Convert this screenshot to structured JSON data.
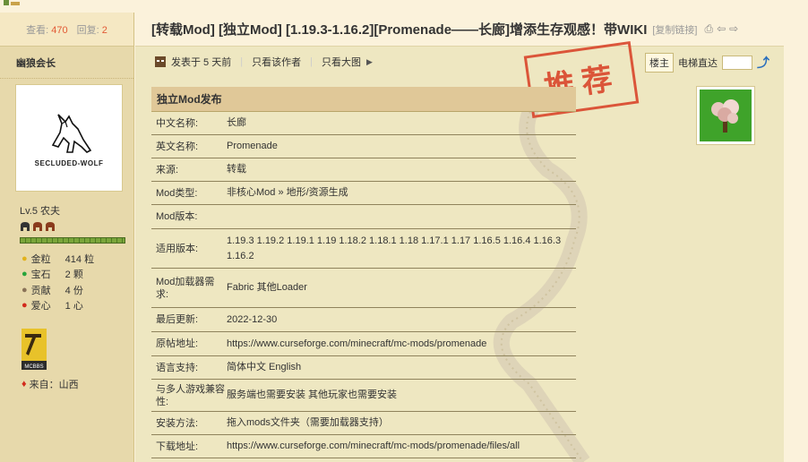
{
  "stats": {
    "views_label": "查看:",
    "views": "470",
    "replies_label": "回复:",
    "replies": "2"
  },
  "user": {
    "name": "幽狼会长",
    "avatar_text": "SECLUDED-WOLF",
    "level": "Lv.5 农夫",
    "gold_label": "金粒",
    "gold": "414 粒",
    "gem_label": "宝石",
    "gem": "2 颗",
    "contrib_label": "贡献",
    "contrib": "4 份",
    "love_label": "爱心",
    "love": "1 心",
    "from": "来自：山西"
  },
  "post": {
    "title": "[转载Mod] [独立Mod] [1.19.3-1.16.2][Promenade——长廊]增添生存观感！带WIKI",
    "copy_link": "[复制链接]",
    "posted": "发表于 5 天前",
    "author_only": "只看该作者",
    "big_images": "只看大图",
    "floor": "楼主",
    "jump_label": "电梯直达",
    "stamp": "推荐"
  },
  "info_table": {
    "header": "独立Mod发布",
    "rows": [
      {
        "k": "中文名称:",
        "v": "长廊"
      },
      {
        "k": "英文名称:",
        "v": "Promenade"
      },
      {
        "k": "来源:",
        "v": "转载"
      },
      {
        "k": "Mod类型:",
        "v": "非核心Mod » 地形/资源生成"
      },
      {
        "k": "Mod版本:",
        "v": ""
      },
      {
        "k": "适用版本:",
        "v": "1.19.3 1.19.2 1.19.1 1.19 1.18.2 1.18.1 1.18 1.17.1 1.17 1.16.5 1.16.4 1.16.3 1.16.2"
      },
      {
        "k": "Mod加载器需求:",
        "v": "Fabric 其他Loader"
      },
      {
        "k": "最后更新:",
        "v": "2022-12-30"
      },
      {
        "k": "原帖地址:",
        "v": "https://www.curseforge.com/minecraft/mc-mods/promenade"
      },
      {
        "k": "语言支持:",
        "v": "简体中文 English"
      },
      {
        "k": "与多人游戏兼容性:",
        "v": "服务端也需要安装 其他玩家也需要安装"
      },
      {
        "k": "安装方法:",
        "v": "拖入mods文件夹（需要加载器支持）"
      },
      {
        "k": "下载地址:",
        "v": "https://www.curseforge.com/minecraft/mc-mods/promenade/files/all"
      }
    ]
  }
}
